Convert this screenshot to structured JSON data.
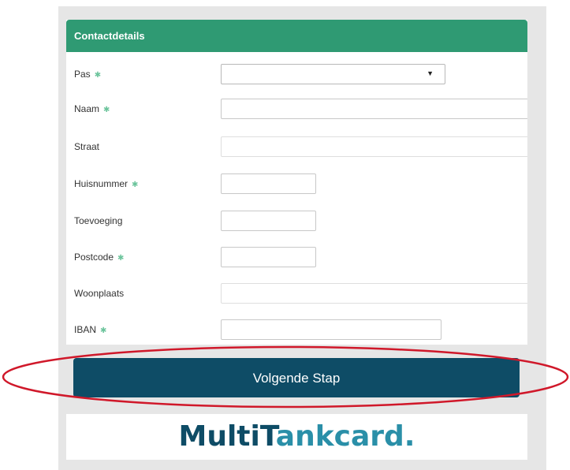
{
  "form": {
    "section_title": "Contactdetails",
    "required_marker": "✱",
    "fields": [
      {
        "label": "Pas",
        "required": true,
        "type": "select",
        "value": ""
      },
      {
        "label": "Naam",
        "required": true,
        "type": "text",
        "value": ""
      },
      {
        "label": "Straat",
        "required": false,
        "type": "text",
        "value": ""
      },
      {
        "label": "Huisnummer",
        "required": true,
        "type": "text",
        "value": ""
      },
      {
        "label": "Toevoeging",
        "required": false,
        "type": "text",
        "value": ""
      },
      {
        "label": "Postcode",
        "required": true,
        "type": "text",
        "value": ""
      },
      {
        "label": "Woonplaats",
        "required": false,
        "type": "text",
        "value": ""
      },
      {
        "label": "IBAN",
        "required": true,
        "type": "text",
        "value": ""
      }
    ],
    "select_arrow": "▼",
    "next_button_label": "Volgende Stap"
  },
  "brand": {
    "logo_part1": "MultiT",
    "logo_part2": "ankcard.",
    "colors": {
      "header_green": "#2f9a73",
      "button_navy": "#0e4c66",
      "highlight_red": "#d0182a",
      "logo_teal": "#2a8fa8"
    }
  }
}
